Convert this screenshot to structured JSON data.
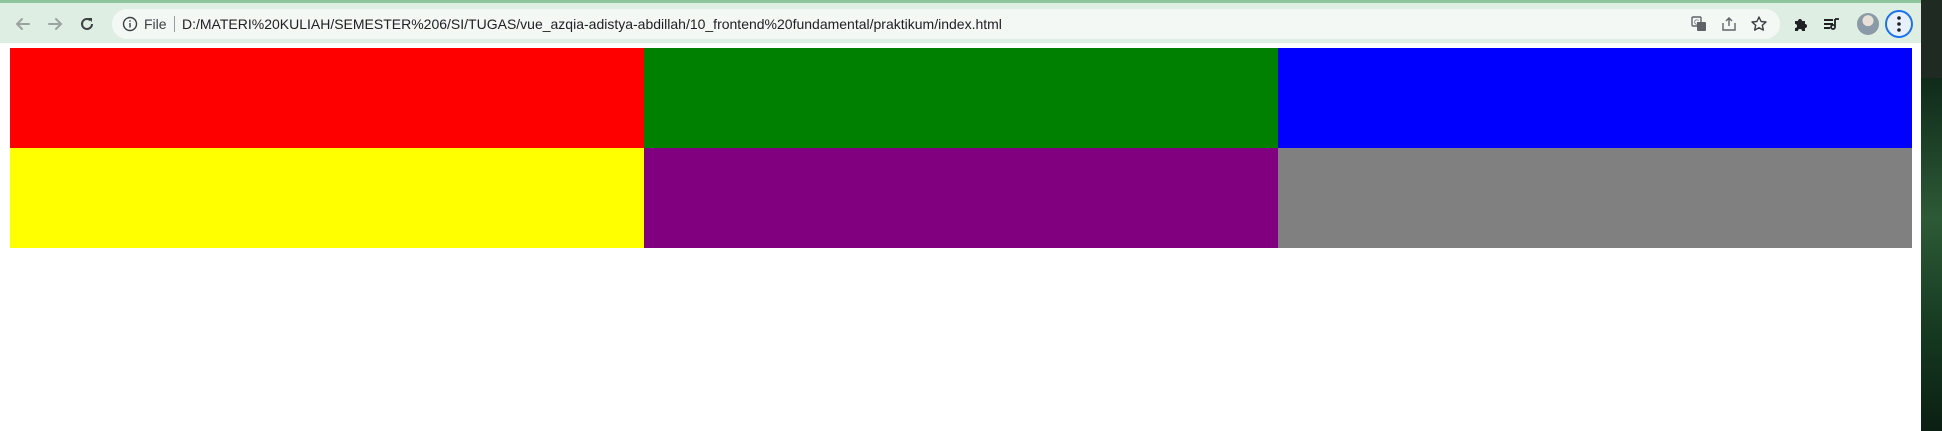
{
  "browser": {
    "omnibox": {
      "scheme_label": "File",
      "url": "D:/MATERI%20KULIAH/SEMESTER%206/SI/TUGAS/vue_azqia-adistya-abdillah/10_frontend%20fundamental/praktikum/index.html"
    },
    "icons": {
      "back": "back-arrow-icon",
      "forward": "forward-arrow-icon",
      "reload": "reload-icon",
      "info": "info-icon",
      "translate": "translate-icon",
      "share": "share-icon",
      "bookmark": "star-icon",
      "extensions": "puzzle-icon",
      "reading_list": "reading-list-icon",
      "profile": "avatar",
      "menu": "kebab-menu-icon"
    },
    "accent_color": "#1a73e8",
    "toolbar_color": "#dfeee3"
  },
  "page": {
    "boxes": [
      {
        "color": "#ff0000"
      },
      {
        "color": "#008000"
      },
      {
        "color": "#0000ff"
      },
      {
        "color": "#ffff00"
      },
      {
        "color": "#800080"
      },
      {
        "color": "#808080"
      }
    ]
  }
}
